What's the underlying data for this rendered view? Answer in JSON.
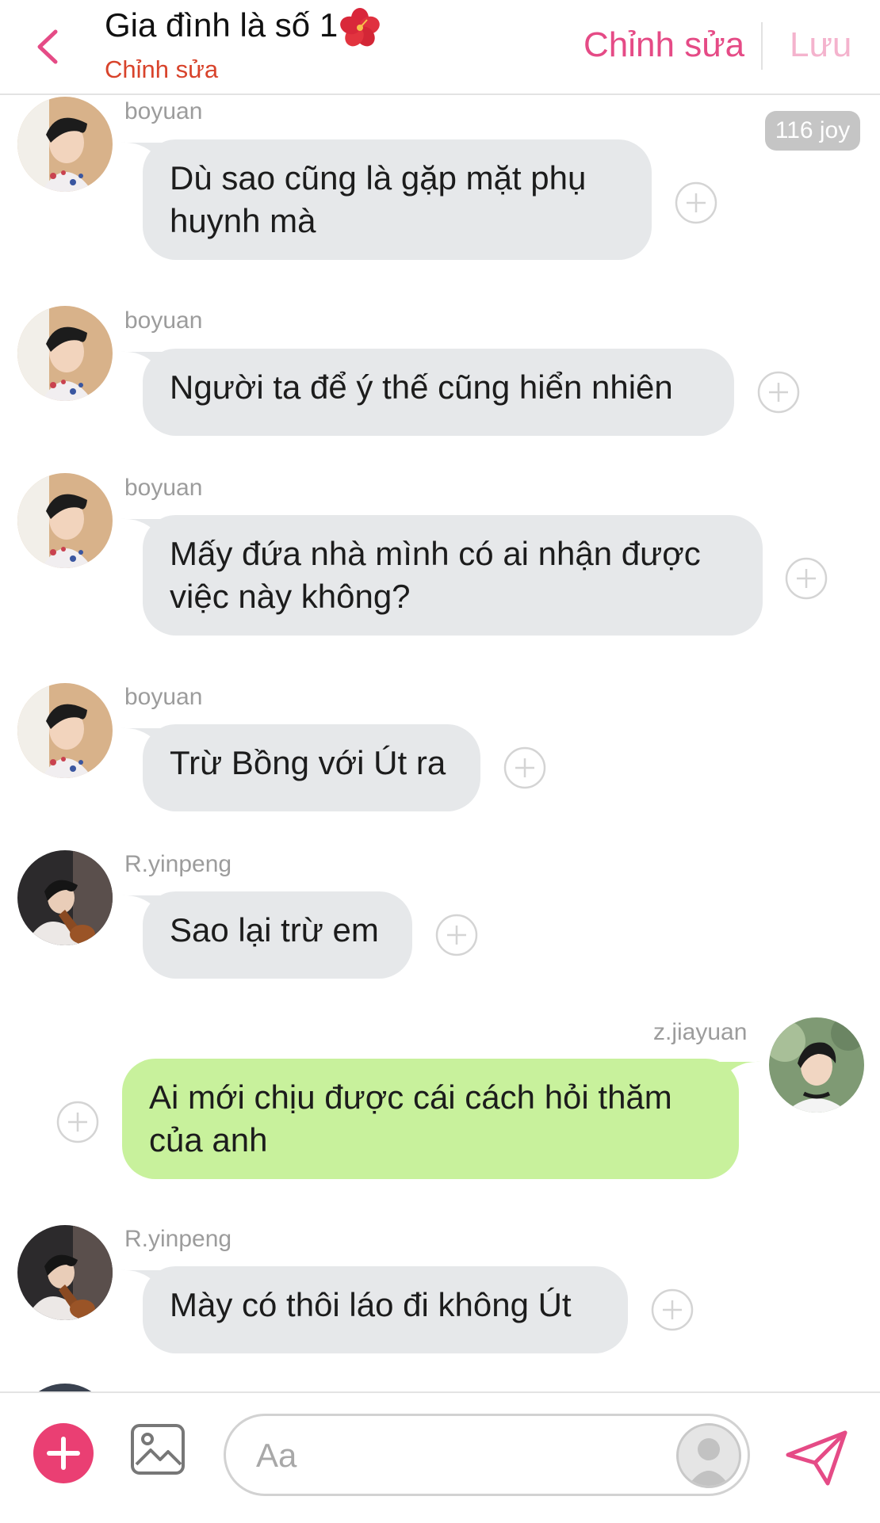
{
  "header": {
    "title": "Gia đình là số 1",
    "title_emoji": "hibiscus-flower",
    "subtitle": "Chỉnh sửa",
    "edit_label": "Chỉnh sửa",
    "save_label": "Lưu"
  },
  "chat": {
    "badge": "116 joy",
    "messages": [
      {
        "user": "boyuan",
        "lines": [
          "Dù sao cũng là gặp mặt phụ",
          "huynh mà"
        ],
        "side": "left"
      },
      {
        "user": "boyuan",
        "lines": [
          "Người ta để ý thế cũng hiển nhiên"
        ],
        "side": "left"
      },
      {
        "user": "boyuan",
        "lines": [
          "Mấy đứa nhà mình có ai nhận được",
          "việc này không?"
        ],
        "side": "left"
      },
      {
        "user": "boyuan",
        "lines": [
          "Trừ Bồng với Út ra"
        ],
        "side": "left"
      },
      {
        "user": "R.yinpeng",
        "lines": [
          "Sao lại trừ em"
        ],
        "side": "left"
      },
      {
        "user": "z.jiayuan",
        "lines": [
          "Ai mới chịu được cái cách hỏi thăm",
          "của anh"
        ],
        "side": "right"
      },
      {
        "user": "R.yinpeng",
        "lines": [
          "Mày có thôi láo đi không Út"
        ],
        "side": "left"
      }
    ]
  },
  "composer": {
    "placeholder": "Aa"
  },
  "colors": {
    "accent_pink": "#e54b86",
    "subtitle_red": "#d8432b",
    "bubble_gray": "#e6e8ea",
    "bubble_green": "#c8f19c",
    "add_button": "#ea3f73"
  }
}
